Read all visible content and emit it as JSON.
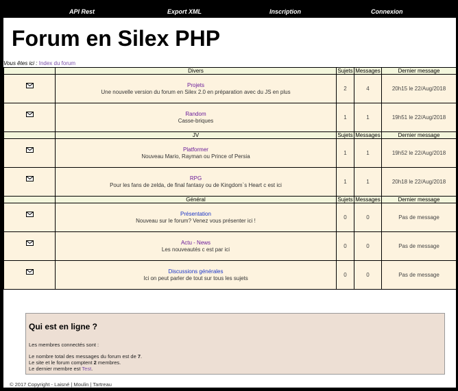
{
  "nav": {
    "api": "API Rest",
    "export": "Export XML",
    "inscription": "Inscription",
    "connexion": "Connexion"
  },
  "title": "Forum en Silex PHP",
  "breadcrumb": {
    "prefix": "Vous êtes ici : ",
    "link": "Index du forum"
  },
  "columns": {
    "sujets": "Sujets",
    "messages": "Messages",
    "dernier": "Dernier message"
  },
  "categories": [
    {
      "name": "Divers",
      "forums": [
        {
          "name": "Projets",
          "desc": "Une nouvelle version du forum en Silex 2.0 en préparation avec du JS en plus",
          "sujets": "2",
          "messages": "4",
          "last": "20h15 le 22/Aug/2018"
        },
        {
          "name": "Random",
          "desc": "Casse-briques",
          "sujets": "1",
          "messages": "1",
          "last": "19h51 le 22/Aug/2018"
        }
      ]
    },
    {
      "name": "JV",
      "forums": [
        {
          "name": "Platformer",
          "desc": "Nouveau Mario, Rayman ou Prince of Persia",
          "sujets": "1",
          "messages": "1",
          "last": "19h52 le 22/Aug/2018"
        },
        {
          "name": "RPG",
          "desc": "Pour les fans de zelda, de final fantasy ou de Kingdom`s Heart c est ici",
          "sujets": "1",
          "messages": "1",
          "last": "20h18 le 22/Aug/2018"
        }
      ]
    },
    {
      "name": "Général",
      "forums": [
        {
          "name": "Présentation",
          "desc": "Nouveau sur le forum? Venez vous présenter ici !",
          "sujets": "0",
          "messages": "0",
          "last": "Pas de message"
        },
        {
          "name": "Actu - News",
          "desc": "Les nouveautés c est par ici",
          "sujets": "0",
          "messages": "0",
          "last": "Pas de message"
        },
        {
          "name": "Discussions générales",
          "desc": "Ici on peut parler de tout sur tous les sujets",
          "sujets": "0",
          "messages": "0",
          "last": "Pas de message"
        }
      ]
    }
  ],
  "online": {
    "title": "Qui est en ligne ?",
    "members_line": "Les membres connectés sont :",
    "total_prefix": "Le nombre total des messages du forum est de ",
    "total_value": "7",
    "total_suffix": ".",
    "count_prefix": "Le site et le forum comptent ",
    "count_value": "2",
    "count_suffix": " membres.",
    "last_prefix": "Le dernier membre est ",
    "last_member": "Test",
    "last_suffix": "."
  },
  "footer": "© 2017 Copyright - Laisné | Moulin | Tartreau",
  "colors": {
    "row_bg": "#fdf3df",
    "header_bg": "#f3f6dc",
    "online_bg": "#eddfd4",
    "link_visited": "#6a1b9a",
    "link": "#1a35c8"
  },
  "icons": {
    "forum": "envelope-icon"
  }
}
